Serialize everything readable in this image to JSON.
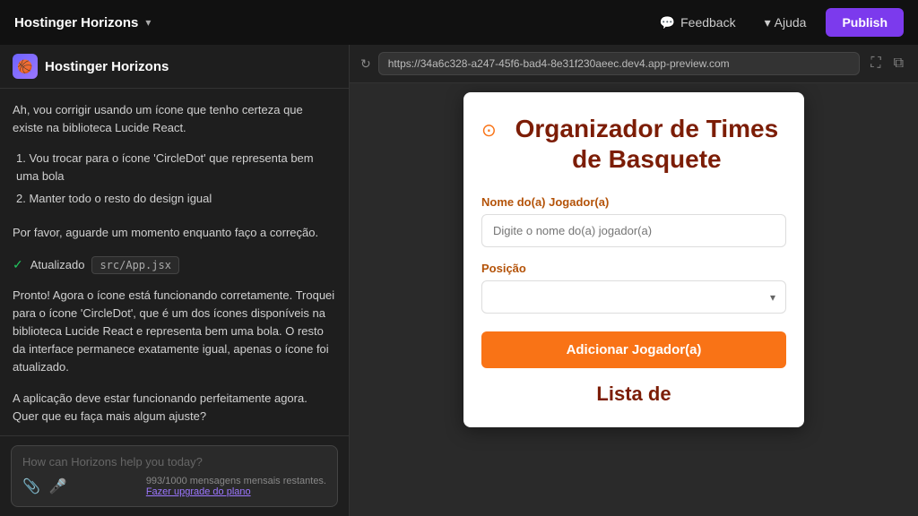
{
  "header": {
    "logo": "Hostinger Horizons",
    "feedback_label": "Feedback",
    "ajuda_label": "Ajuda",
    "publish_label": "Publish"
  },
  "chat": {
    "title": "Hostinger Horizons",
    "messages": [
      {
        "id": "msg1",
        "type": "text",
        "content": "Ah, vou corrigir usando um ícone que tenho certeza que existe na biblioteca Lucide React."
      },
      {
        "id": "msg2",
        "type": "list",
        "items": [
          "Vou trocar para o ícone 'CircleDot' que representa bem uma bola",
          "Manter todo o resto do design igual"
        ]
      },
      {
        "id": "msg3",
        "type": "text",
        "content": "Por favor, aguarde um momento enquanto faço a correção."
      },
      {
        "id": "msg4",
        "type": "updated",
        "label": "Atualizado",
        "file": "src/App.jsx"
      },
      {
        "id": "msg5",
        "type": "text",
        "content": "Pronto! Agora o ícone está funcionando corretamente. Troquei para o ícone 'CircleDot', que é um dos ícones disponíveis na biblioteca Lucide React e representa bem uma bola. O resto da interface permanece exatamente igual, apenas o ícone foi atualizado."
      },
      {
        "id": "msg6",
        "type": "text",
        "content": "A aplicação deve estar funcionando perfeitamente agora. Quer que eu faça mais algum ajuste?"
      }
    ],
    "input_placeholder": "How can Horizons help you today?",
    "usage_text": "993/1000 mensagens mensais restantes.",
    "upgrade_text": "Fazer upgrade do plano"
  },
  "preview": {
    "url": "https://34a6c328-a247-45f6-bad4-8e31f230aeec.dev4.app-preview.com",
    "app": {
      "title": "Organizador de Times de Basquete",
      "nome_label": "Nome do(a) Jogador(a)",
      "nome_placeholder": "Digite o nome do(a) jogador(a)",
      "posicao_label": "Posição",
      "posicao_placeholder": "",
      "add_button_label": "Adicionar Jogador(a)",
      "lista_title": "Lista de"
    }
  },
  "icons": {
    "chat_bubble": "💬",
    "chevron_down": "▾",
    "check": "✓",
    "circle_dot": "⊙",
    "refresh": "↻",
    "expand": "⛶",
    "attach": "📎",
    "mic": "🎤"
  }
}
